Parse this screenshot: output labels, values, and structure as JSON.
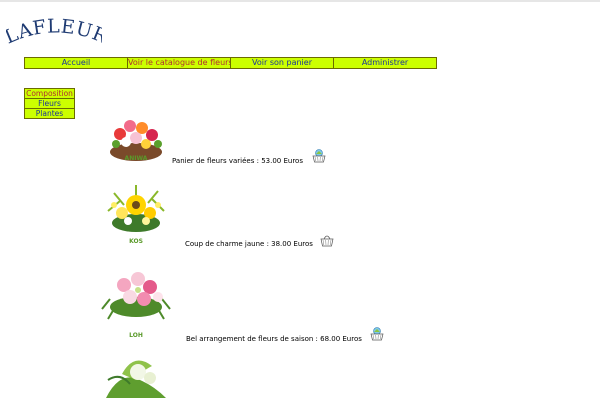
{
  "brand": {
    "logo_text": "LAFLEUR"
  },
  "nav": [
    {
      "label": "Accueil"
    },
    {
      "label": "Voir le catalogue de fleurs"
    },
    {
      "label": "Voir son panier"
    },
    {
      "label": "Administrer"
    }
  ],
  "sidebar": [
    {
      "label": "Composition"
    },
    {
      "label": "Fleurs"
    },
    {
      "label": "Plantes"
    }
  ],
  "products": [
    {
      "code": "ANIWA",
      "description": "Panier de fleurs variées : 53.00 Euros"
    },
    {
      "code": "KOS",
      "description": "Coup de charme jaune : 38.00 Euros"
    },
    {
      "code": "LOH",
      "description": "Bel arrangement de fleurs de saison : 68.00 Euros"
    }
  ],
  "colors": {
    "menu_bg": "#ccff00",
    "menu_text": "#1a3399",
    "menu_active_text": "#b03030",
    "logo": "#1f3b73",
    "code_text": "#5a9a2a"
  }
}
